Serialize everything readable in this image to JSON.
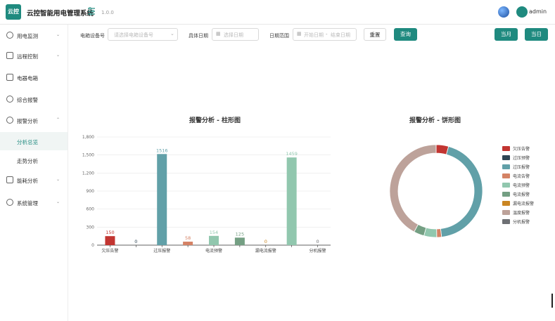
{
  "header": {
    "logo_text": "云控",
    "title": "云控智能用电管理系统",
    "version": "1.0.0",
    "username": "admin"
  },
  "sidebar": {
    "items": [
      {
        "label": "用电监测",
        "icon": "monitor-icon"
      },
      {
        "label": "远程控制",
        "icon": "remote-control-icon"
      },
      {
        "label": "电器电箱",
        "icon": "device-icon"
      },
      {
        "label": "综合报警",
        "icon": "alarm-icon"
      },
      {
        "label": "报警分析",
        "icon": "analysis-icon",
        "expanded": true
      },
      {
        "label": "能耗分析",
        "icon": "energy-icon"
      },
      {
        "label": "系统管理",
        "icon": "settings-icon"
      }
    ],
    "sub_items": [
      {
        "label": "分析总览",
        "active": true
      },
      {
        "label": "走势分析",
        "active": false
      }
    ]
  },
  "filters": {
    "device_label": "电箱设备号",
    "device_placeholder": "请选择电箱设备号",
    "date_label": "具体日期",
    "date_placeholder": "选择日期",
    "range_label": "日期范围",
    "range_start_placeholder": "开始日期",
    "range_separator": "-",
    "range_end_placeholder": "结束日期",
    "reset_label": "重置",
    "query_label": "查询",
    "month_label": "当月",
    "day_label": "当日"
  },
  "colors": {
    "accent": "#1f8a7f"
  },
  "chart_data": [
    {
      "type": "bar",
      "title": "报警分析 - 柱形图",
      "categories": [
        "欠压告警",
        "过压报警",
        "过压报警",
        "电流告警",
        "电流预警",
        "电流报警",
        "漏电流报警",
        "温度报警",
        "分机报警"
      ],
      "x_tick_labels": [
        "欠压告警",
        "",
        "过压报警",
        "",
        "电流预警",
        "",
        "漏电流报警",
        "",
        "分机报警"
      ],
      "values": [
        150,
        0,
        1516,
        58,
        154,
        125,
        0,
        1459,
        0
      ],
      "colors": [
        "#c23531",
        "#2f4554",
        "#61a0a8",
        "#d48265",
        "#91c7ae",
        "#749f83",
        "#ca8622",
        "#91c7ae",
        "#6e7074"
      ],
      "ylim": [
        0,
        1800
      ],
      "yticks": [
        0,
        300,
        600,
        900,
        1200,
        1500,
        1800
      ],
      "ytick_labels": [
        "0",
        "300",
        "600",
        "900",
        "1,200",
        "1,500",
        "1,800"
      ],
      "grid": true
    },
    {
      "type": "pie",
      "title": "报警分析 - 饼形图",
      "labels": [
        "欠压告警",
        "过压预警",
        "过压报警",
        "电流告警",
        "电流预警",
        "电流报警",
        "漏电流报警",
        "温度报警",
        "分机报警"
      ],
      "values": [
        150,
        0,
        1516,
        58,
        154,
        125,
        0,
        1459,
        0
      ],
      "colors": [
        "#c23531",
        "#2f4554",
        "#61a0a8",
        "#d48265",
        "#91c7ae",
        "#749f83",
        "#ca8622",
        "#bda29a",
        "#6e7074"
      ],
      "legend_position": "right"
    }
  ]
}
